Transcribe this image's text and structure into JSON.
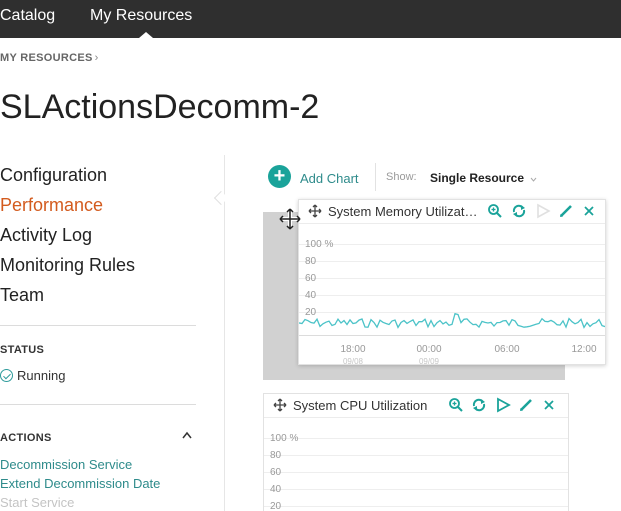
{
  "nav": {
    "catalog": "Catalog",
    "my_resources": "My Resources"
  },
  "breadcrumb": {
    "label": "MY RESOURCES",
    "chevron": "›"
  },
  "page_title": "SLActionsDecomm-2",
  "sidebar": {
    "items": [
      {
        "label": "Configuration",
        "active": false
      },
      {
        "label": "Performance",
        "active": true
      },
      {
        "label": "Activity Log",
        "active": false
      },
      {
        "label": "Monitoring Rules",
        "active": false
      },
      {
        "label": "Team",
        "active": false
      }
    ],
    "status": {
      "heading": "STATUS",
      "value": "Running"
    },
    "actions": {
      "heading": "ACTIONS",
      "collapse_icon": "chevron-up-icon",
      "links": [
        {
          "label": "Decommission Service",
          "enabled": true
        },
        {
          "label": "Extend Decommission Date",
          "enabled": true
        },
        {
          "label": "Start Service",
          "enabled": false
        }
      ]
    }
  },
  "toolbar": {
    "add_chart": "Add Chart",
    "show_label": "Show:",
    "show_value": "Single Resource",
    "dropdown_icon": "chevron-down-icon"
  },
  "charts": [
    {
      "title": "System Memory Utilization",
      "y_ticks": [
        "100 %",
        "80",
        "60",
        "40",
        "20"
      ],
      "x_ticks": [
        "18:00",
        "00:00",
        "06:00",
        "12:00"
      ],
      "x_sub": [
        "09/08",
        "09/09",
        "",
        ""
      ],
      "icons": [
        "move-icon",
        "zoom-icon",
        "refresh-icon",
        "play-icon",
        "edit-icon",
        "close-icon"
      ]
    },
    {
      "title": "System CPU Utilization",
      "y_ticks": [
        "100 %",
        "80",
        "60",
        "40",
        "20"
      ],
      "icons": [
        "move-icon",
        "zoom-icon",
        "refresh-icon",
        "play-icon",
        "edit-icon",
        "close-icon"
      ]
    }
  ],
  "colors": {
    "accent": "#1aa39a",
    "link": "#2e8b8b",
    "active_nav": "#d35b1e",
    "series": "#4cc3c8",
    "topbar": "#2f2f2f"
  }
}
